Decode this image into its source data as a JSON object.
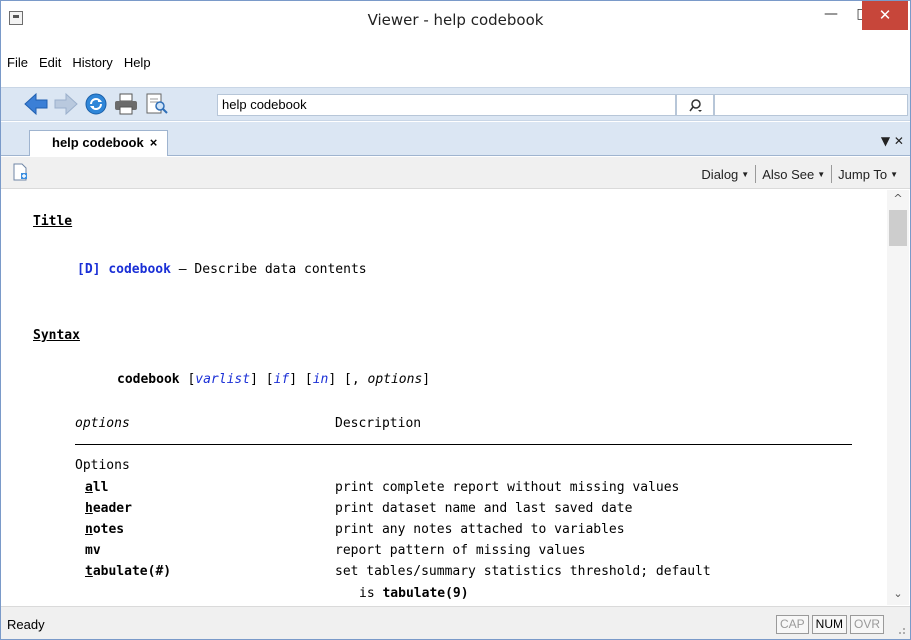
{
  "window": {
    "title": "Viewer - help codebook"
  },
  "menu": [
    "File",
    "Edit",
    "History",
    "Help"
  ],
  "toolbar": {
    "address_value": "help codebook",
    "search_value": ""
  },
  "tab": {
    "label": "help codebook",
    "close": "×"
  },
  "helpbar": {
    "dialog": "Dialog",
    "also_see": "Also See",
    "jump_to": "Jump To"
  },
  "content": {
    "title_heading": "Title",
    "title_ref": "[D]",
    "title_cmd": "codebook",
    "title_desc": " — Describe data contents",
    "syntax_heading": "Syntax",
    "syntax": {
      "cmd": "codebook",
      "varlist": "varlist",
      "if": "if",
      "in": "in",
      "options": "options"
    },
    "table_header": {
      "col1": "options",
      "col2": "Description"
    },
    "group_label": "Options",
    "options": [
      {
        "name": "all",
        "desc": "print complete report without missing values"
      },
      {
        "name": "header",
        "desc": "print dataset name and last saved date"
      },
      {
        "name": "notes",
        "desc": "print any notes attached to variables"
      },
      {
        "name": "mv",
        "desc": "report pattern of missing values"
      },
      {
        "name": "tabulate(#)",
        "desc": "set tables/summary statistics threshold; default"
      }
    ],
    "tab_cont_prefix": "is ",
    "tab_cont_value": "tabulate(9)"
  },
  "status": {
    "text": "Ready",
    "indicators": [
      "CAP",
      "NUM",
      "OVR"
    ]
  },
  "colors": {
    "link": "#1a2fd6",
    "toolbar_bg": "#dbe6f3",
    "close_button": "#c7463a"
  }
}
